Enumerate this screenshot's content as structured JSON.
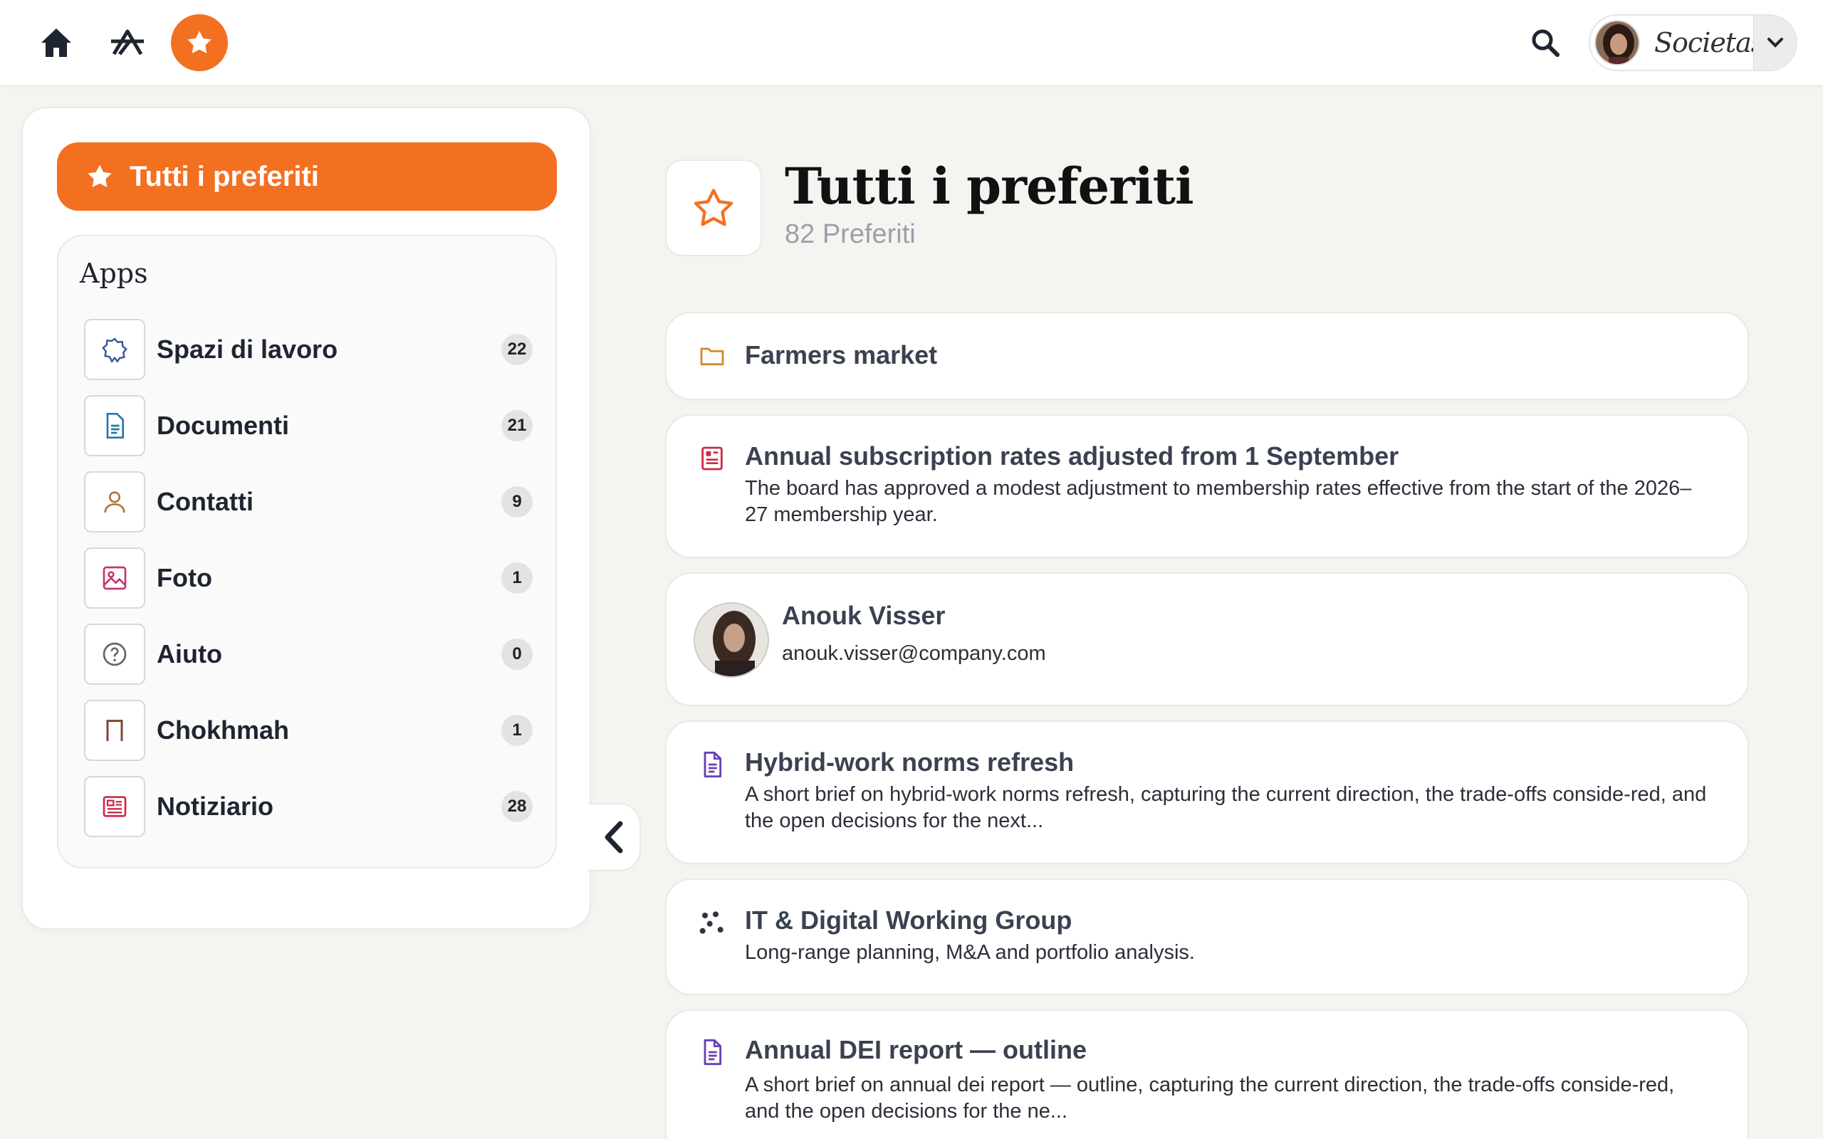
{
  "topbar": {
    "org_name": "Societas"
  },
  "sidebar": {
    "all_favorites_label": "Tutti i preferiti",
    "apps_title": "Apps",
    "items": [
      {
        "label": "Spazi di lavoro",
        "count": "22",
        "icon": "workspace-star-icon"
      },
      {
        "label": "Documenti",
        "count": "21",
        "icon": "document-icon"
      },
      {
        "label": "Contatti",
        "count": "9",
        "icon": "person-icon"
      },
      {
        "label": "Foto",
        "count": "1",
        "icon": "image-icon"
      },
      {
        "label": "Aiuto",
        "count": "0",
        "icon": "help-icon"
      },
      {
        "label": "Chokhmah",
        "count": "1",
        "icon": "arch-icon"
      },
      {
        "label": "Notiziario",
        "count": "28",
        "icon": "newspaper-icon"
      }
    ]
  },
  "main": {
    "title": "Tutti i preferiti",
    "subtitle": "82 Preferiti",
    "cards": [
      {
        "type": "folder",
        "title": "Farmers market",
        "desc": ""
      },
      {
        "type": "news",
        "title": "Annual subscription rates adjusted from 1 September",
        "desc": "The board has approved a modest adjustment to membership rates effective from the start of the 2026–27 membership year."
      },
      {
        "type": "contact",
        "title": "Anouk Visser",
        "desc": "anouk.visser@company.com"
      },
      {
        "type": "document",
        "title": "Hybrid-work norms refresh",
        "desc": "A short brief on hybrid-work norms refresh, capturing the current direction, the trade-offs conside-red, and the open decisions for the next..."
      },
      {
        "type": "group",
        "title": "IT & Digital Working Group",
        "desc": "Long-range planning, M&A and portfolio analysis."
      },
      {
        "type": "document",
        "title": "Annual DEI report — outline",
        "desc": "A short brief on annual dei report — outline, capturing the current direction, the trade-offs conside-red, and the open decisions for the ne..."
      }
    ]
  },
  "colors": {
    "accent": "#f37021",
    "background": "#f6f4f1"
  }
}
